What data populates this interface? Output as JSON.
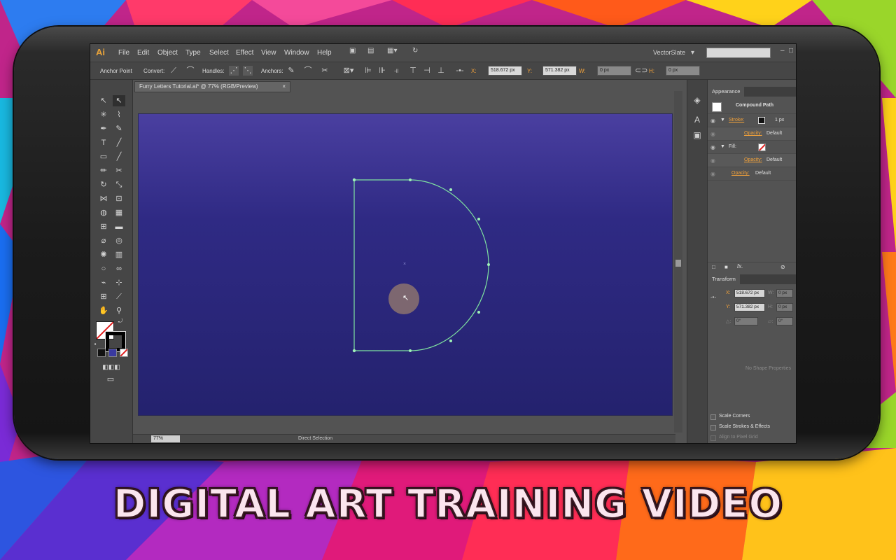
{
  "background": {
    "colors": [
      "#2d7cf0",
      "#ff2d55",
      "#ffd21a",
      "#8a33d6",
      "#18c35a",
      "#ff7a1a",
      "#e61a7a"
    ]
  },
  "app": {
    "logo": "Ai",
    "menu": [
      "File",
      "Edit",
      "Object",
      "Type",
      "Select",
      "Effect",
      "View",
      "Window",
      "Help"
    ],
    "workspace": "VectorSlate"
  },
  "control_bar": {
    "anchor_point": "Anchor Point",
    "convert": "Convert:",
    "handles": "Handles:",
    "anchors": "Anchors:",
    "x_label": "X:",
    "x_value": "518.672 px",
    "y_label": "Y:",
    "y_value": "571.382 px",
    "w_label": "W:",
    "w_value": "0 px",
    "h_label": "H:",
    "h_value": "0 px"
  },
  "document": {
    "tab_title": "Furry Letters Tutorial.ai* @ 77% (RGB/Preview)",
    "tab_close": "×",
    "zoom": "77%",
    "status": "Direct Selection"
  },
  "appearance": {
    "tab": "Appearance",
    "object": "Compound Path",
    "stroke_label": "Stroke:",
    "stroke_weight": "1 px",
    "opacity_label": "Opacity:",
    "opacity_value": "Default",
    "fill_label": "Fill:",
    "opacity2_label": "Opacity:",
    "opacity2_value": "Default",
    "opacity3_label": "Opacity:",
    "opacity3_value": "Default"
  },
  "transform": {
    "tab": "Transform",
    "x_label": "X:",
    "x_value": "518.672 px",
    "y_label": "Y:",
    "y_value": "571.382 px",
    "w_label": "W:",
    "w_value": "0 px",
    "h_label": "H:",
    "h_value": "0 px",
    "angle_value": "0°",
    "shear_value": "0°",
    "no_shape": "No Shape Properties",
    "scale_corners": "Scale Corners",
    "scale_strokes": "Scale Strokes & Effects",
    "align_pixel": "Align to Pixel Grid"
  },
  "colors": {
    "path_stroke": "#7fe3a0",
    "accent": "#f3a23a",
    "artboard_top": "#4a3fa0",
    "artboard_bottom": "#24226e"
  },
  "banner": {
    "title": "DIGITAL ART TRAINING VIDEO"
  }
}
